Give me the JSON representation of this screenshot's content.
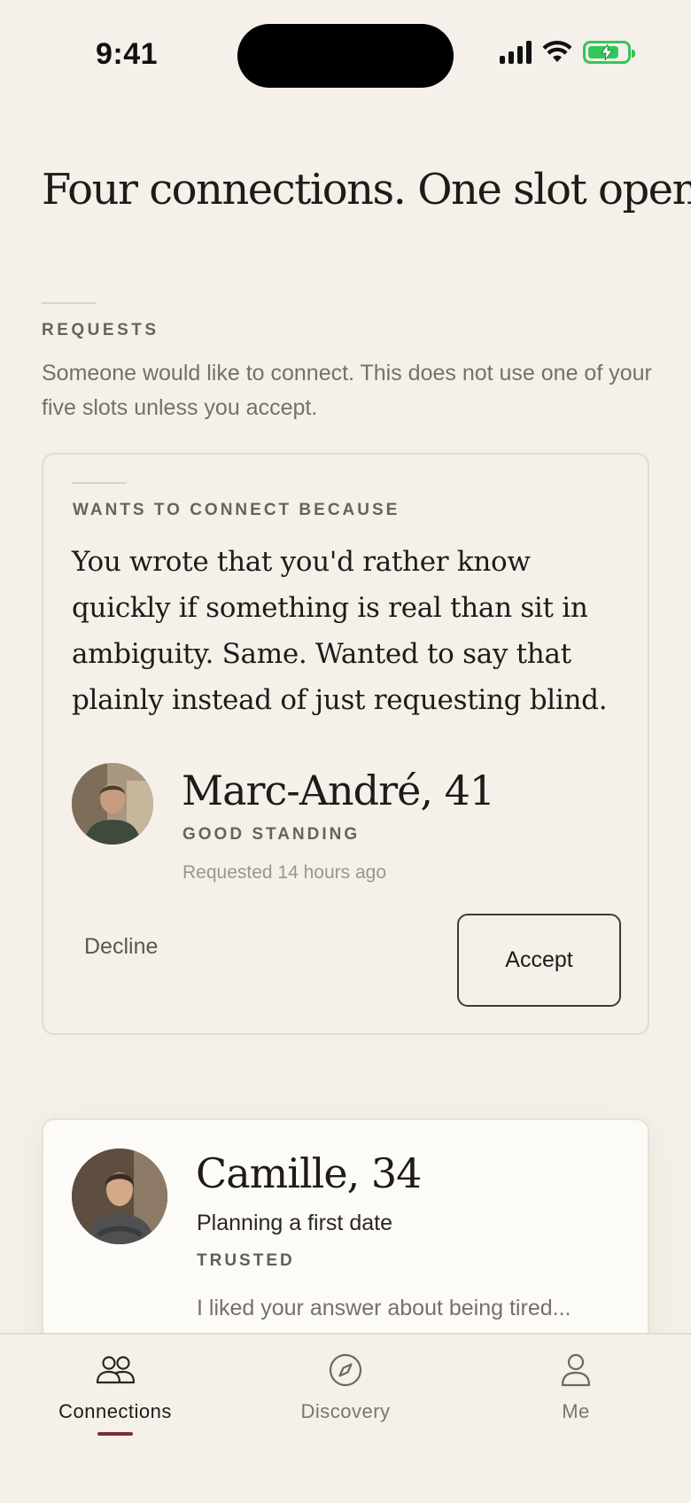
{
  "status_bar": {
    "time": "9:41"
  },
  "headline": "Four connections. One slot open.",
  "requests_section": {
    "label": "REQUESTS",
    "description": "Someone would like to connect. This does not use one of your five slots unless you accept."
  },
  "request_card": {
    "label": "WANTS TO CONNECT BECAUSE",
    "quote": "You wrote that you'd rather know quickly if something is real than sit in ambiguity. Same. Wanted to say that plainly instead of just requesting blind.",
    "name": "Marc-André, 41",
    "standing": "GOOD STANDING",
    "requested": "Requested 14 hours ago",
    "decline_label": "Decline",
    "accept_label": "Accept"
  },
  "connection_card": {
    "name": "Camille, 34",
    "status": "Planning a first date",
    "trust": "TRUSTED",
    "preview": "I liked your answer about being tired..."
  },
  "tab_bar": {
    "tabs": [
      {
        "label": "Connections",
        "icon": "people-icon",
        "active": true
      },
      {
        "label": "Discovery",
        "icon": "compass-icon",
        "active": false
      },
      {
        "label": "Me",
        "icon": "person-icon",
        "active": false
      }
    ]
  },
  "colors": {
    "background": "#F5F1EA",
    "accent": "#7A2E35",
    "battery": "#33C759"
  }
}
